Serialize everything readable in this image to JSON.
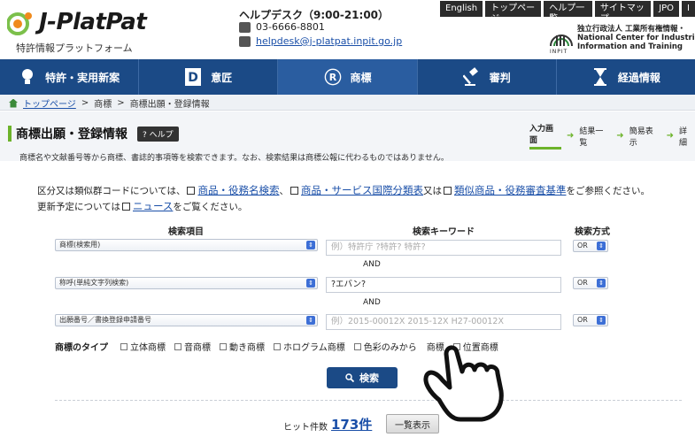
{
  "header": {
    "logo_text": "J-PlatPat",
    "logo_sub": "特許情報プラットフォーム",
    "helpdesk_title": "ヘルプデスク（9:00-21:00）",
    "phone": "03-6666-8801",
    "email": "helpdesk@j-platpat.inpit.go.jp",
    "top_links": [
      "English",
      "トップページ",
      "ヘルプ一覧",
      "サイトマップ",
      "JPO",
      "I"
    ],
    "inpit_line1": "独立行政法人 工業所有権情報・",
    "inpit_line2": "National Center for Industrial Pr",
    "inpit_line3": "Information and Training",
    "inpit_label": "INPIT"
  },
  "nav": {
    "items": [
      {
        "label": "特許・実用新案",
        "icon": "lightbulb-icon"
      },
      {
        "label": "意匠",
        "icon": "design-d-icon"
      },
      {
        "label": "商標",
        "icon": "registered-r-icon"
      },
      {
        "label": "審判",
        "icon": "gavel-icon"
      },
      {
        "label": "経過情報",
        "icon": "hourglass-icon"
      }
    ],
    "active": "商標"
  },
  "breadcrumb": {
    "home": "トップページ",
    "sep": ">",
    "level2": "商標",
    "level3": "商標出願・登録情報"
  },
  "page": {
    "title": "商標出願・登録情報",
    "help": "? ヘルプ",
    "description": "商標名や文献番号等から商標、書誌的事項等を検索できます。なお、検索結果は商標公報に代わるものではありません。"
  },
  "steps": [
    "入力画面",
    "結果一覧",
    "簡易表示",
    "詳細"
  ],
  "info": {
    "line1_prefix": "区分又は類似群コードについては、",
    "link1": "商品・役務名検索",
    "sep1": "、",
    "link2": "商品・サービス国際分類表",
    "sep2": "又は",
    "link3": "類似商品・役務審査基準",
    "line1_suffix": "をご参照ください。",
    "line2_prefix": "更新予定については",
    "link4": "ニュース",
    "line2_suffix": "をご覧ください。"
  },
  "form": {
    "col_item": "検索項目",
    "col_keyword": "検索キーワード",
    "col_method": "検索方式",
    "and_label": "AND",
    "rows": [
      {
        "item": "商標(検索用)",
        "keyword_placeholder": "例）特許庁 ?特許? 特許?",
        "keyword_value": "",
        "method": "OR"
      },
      {
        "item": "称呼(単純文字列検索)",
        "keyword_placeholder": "",
        "keyword_value": "?エバン?",
        "method": "OR"
      },
      {
        "item": "出願番号／書換登録申請番号",
        "keyword_placeholder": "例）2015-00012X 2015-12X H27-00012X",
        "keyword_value": "",
        "method": "OR"
      }
    ]
  },
  "types": {
    "label": "商標のタイプ",
    "options": [
      "立体商標",
      "音商標",
      "動き商標",
      "ホログラム商標",
      "色彩のみから",
      "商標",
      "位置商標"
    ]
  },
  "search_button": "検索",
  "result": {
    "hit_label": "ヒット件数",
    "hit_count": "173件",
    "list_button": "一覧表示"
  }
}
